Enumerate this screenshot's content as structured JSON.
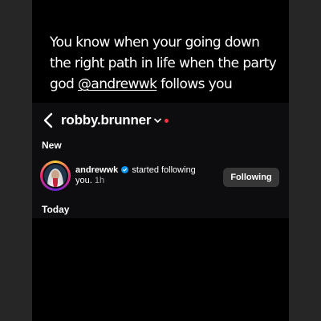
{
  "caption": {
    "text_before": "You know when your going down the right path in life when the party god ",
    "mention": "@andrewwk",
    "text_after": " follows you"
  },
  "header": {
    "username": "robby.brunner",
    "back_icon": "chevron-left-icon",
    "dropdown_icon": "chevron-down-icon",
    "dot_color": "#ff3040"
  },
  "sections": {
    "new_label": "New",
    "today_label": "Today"
  },
  "notification": {
    "username": "andrewwk",
    "verified": true,
    "action_text": "started following",
    "you_text": "you.",
    "time": "1h",
    "button_label": "Following"
  },
  "colors": {
    "background": "#000000",
    "panel": "#0d0d0f",
    "button": "#363636",
    "verified_blue": "#0095f6"
  }
}
